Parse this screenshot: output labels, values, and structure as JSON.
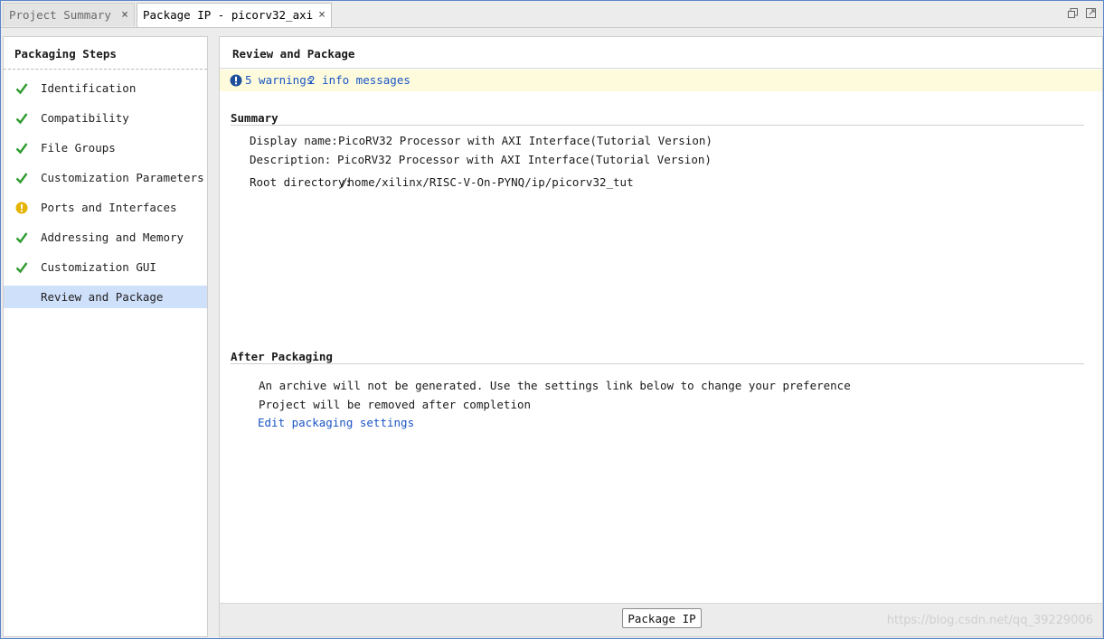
{
  "tabs": [
    {
      "label": "Project Summary",
      "close": "×"
    },
    {
      "label": "Package IP - picorv32_axi",
      "close": "×"
    }
  ],
  "left_panel": {
    "title": "Packaging Steps",
    "steps": [
      {
        "label": "Identification",
        "status": "check"
      },
      {
        "label": "Compatibility",
        "status": "check"
      },
      {
        "label": "File Groups",
        "status": "check"
      },
      {
        "label": "Customization Parameters",
        "status": "check"
      },
      {
        "label": "Ports and Interfaces",
        "status": "warning"
      },
      {
        "label": "Addressing and Memory",
        "status": "check"
      },
      {
        "label": "Customization GUI",
        "status": "check"
      },
      {
        "label": "Review and Package",
        "status": "selected"
      }
    ]
  },
  "main": {
    "title": "Review and Package",
    "messages": {
      "warnings": "5 warnings",
      "info": "2 info messages"
    },
    "summary": {
      "heading": "Summary",
      "display_name_label": "Display name:",
      "display_name": "PicoRV32 Processor with AXI Interface(Tutorial Version)",
      "description_label": "Description:",
      "description": "PicoRV32 Processor with AXI Interface(Tutorial Version)",
      "root_dir_label": "Root directory:",
      "root_dir": "/home/xilinx/RISC-V-On-PYNQ/ip/picorv32_tut"
    },
    "after": {
      "heading": "After Packaging",
      "line1": "An archive will not be generated. Use the settings link below to change your preference",
      "line2": "Project will be removed after completion",
      "link": "Edit packaging settings"
    },
    "button": "Package IP"
  },
  "watermark": "https://blog.csdn.net/qq_39229006",
  "colors": {
    "accent_link": "#1a55c4",
    "check": "#2e9b2e",
    "warning": "#e4b400",
    "selected_bg": "#cfe0fb",
    "info_bar": "#fdfbdc"
  }
}
